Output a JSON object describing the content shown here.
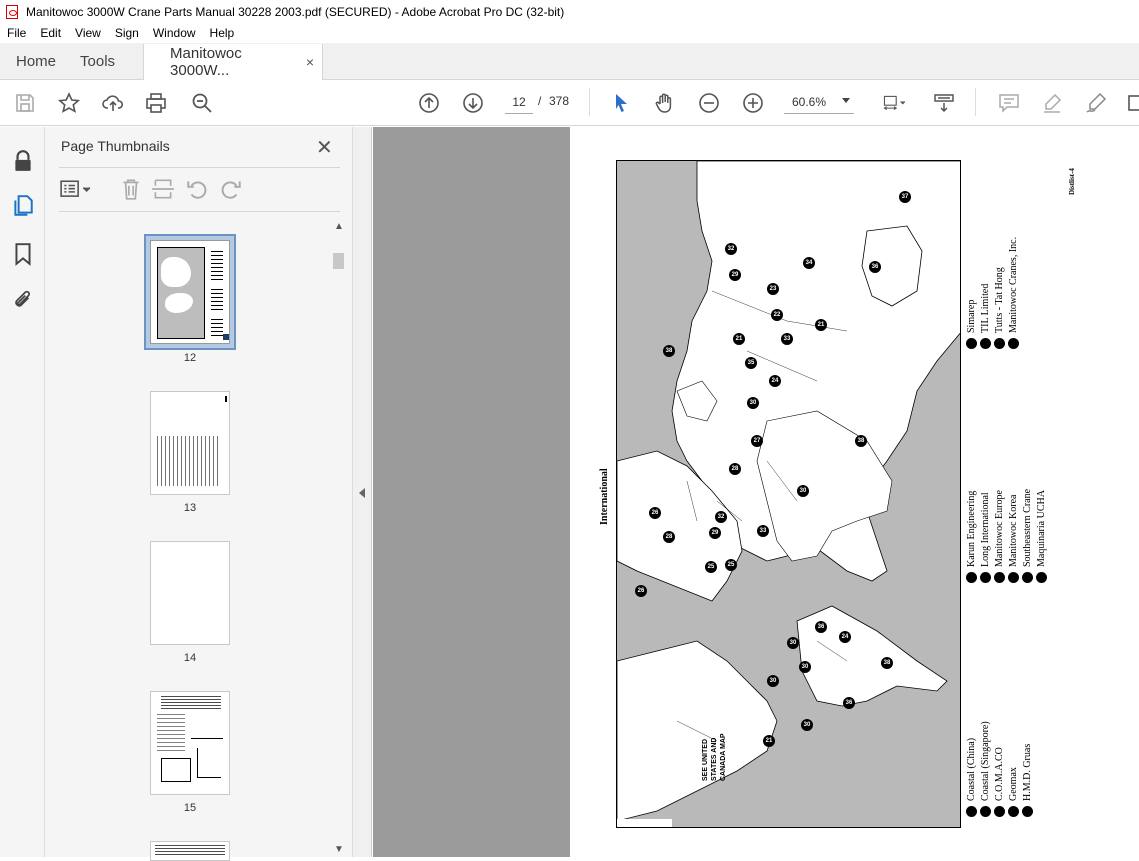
{
  "window": {
    "title": "Manitowoc 3000W Crane Parts Manual 30228 2003.pdf (SECURED) - Adobe Acrobat Pro DC (32-bit)"
  },
  "menu": {
    "file": "File",
    "edit": "Edit",
    "view": "View",
    "sign": "Sign",
    "window": "Window",
    "help": "Help"
  },
  "tabs": {
    "home": "Home",
    "tools": "Tools",
    "document": "Manitowoc 3000W...",
    "close": "×"
  },
  "toolbar": {
    "current_page": "12",
    "page_separator": "/",
    "total_pages": "378",
    "zoom": "60.6%",
    "icons": [
      "save-icon",
      "star-icon",
      "upload-icon",
      "print-icon",
      "zoom-search-icon",
      "page-up-icon",
      "page-down-icon",
      "select-arrow-icon",
      "hand-icon",
      "zoom-out-icon",
      "zoom-in-icon",
      "page-fit-icon",
      "scroll-mode-icon",
      "comment-icon",
      "highlight-icon",
      "sign-icon"
    ]
  },
  "thumbnails_panel": {
    "title": "Page Thumbnails",
    "close": "✕",
    "pages": [
      {
        "label": "12",
        "selected": true
      },
      {
        "label": "13",
        "selected": false
      },
      {
        "label": "14",
        "selected": false
      },
      {
        "label": "15",
        "selected": false
      }
    ]
  },
  "document": {
    "page_header": "Distlist-4",
    "heading": "International",
    "map_label": "SEE UNITED STATES AND CANADA MAP",
    "legend": [
      {
        "num": "",
        "name": "Coastal (China)"
      },
      {
        "num": "",
        "name": "Coastal (Singapore)"
      },
      {
        "num": "",
        "name": "C.O.M.A.CO"
      },
      {
        "num": "",
        "name": "Geomax"
      },
      {
        "num": "",
        "name": "H.M.D. Gruas"
      },
      {
        "num": "",
        "name": "Karun Engineering"
      },
      {
        "num": "",
        "name": "Long International"
      },
      {
        "num": "",
        "name": "Manitowoc Europe"
      },
      {
        "num": "",
        "name": "Manitowoc Korea"
      },
      {
        "num": "",
        "name": "Southeastern Crane"
      },
      {
        "num": "",
        "name": "Maquinaria UCHA"
      },
      {
        "num": "",
        "name": "Simarep"
      },
      {
        "num": "",
        "name": "TIL Limited"
      },
      {
        "num": "",
        "name": "Tutts - Tat Hong"
      },
      {
        "num": "",
        "name": "Manitowoc Cranes, Inc."
      }
    ],
    "map_pins": [
      "21",
      "22",
      "23",
      "24",
      "25",
      "26",
      "27",
      "28",
      "29",
      "30",
      "31",
      "32",
      "33",
      "34",
      "35",
      "36",
      "37",
      "38"
    ]
  }
}
